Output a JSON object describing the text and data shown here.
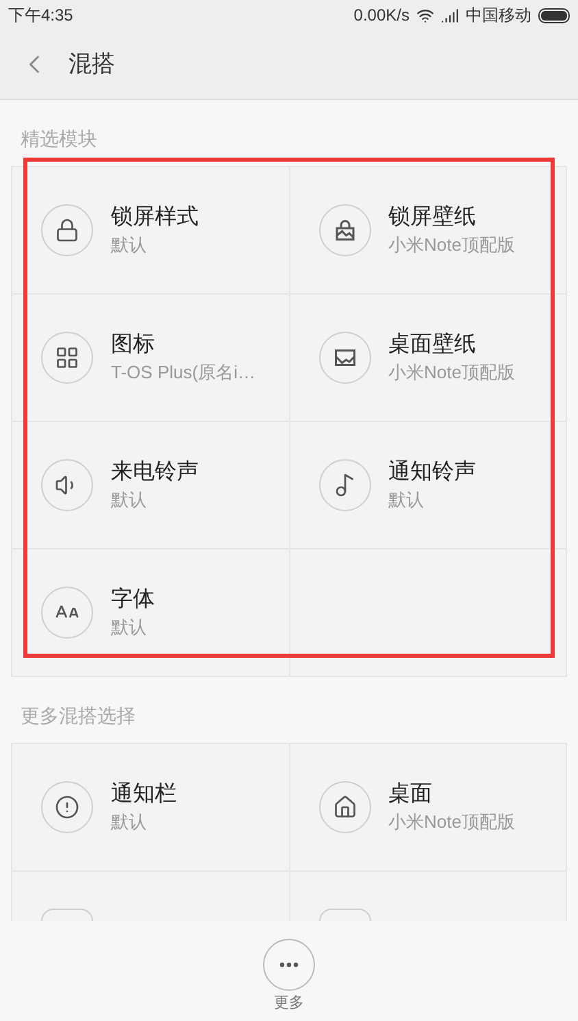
{
  "status_bar": {
    "time": "下午4:35",
    "speed": "0.00K/s",
    "carrier": "中国移动"
  },
  "header": {
    "title": "混搭"
  },
  "sections": [
    {
      "title": "精选模块",
      "highlighted": true,
      "items": [
        {
          "title": "锁屏样式",
          "subtitle": "默认",
          "kind": "lock"
        },
        {
          "title": "锁屏壁纸",
          "subtitle": "小米Note顶配版",
          "kind": "lock-image"
        },
        {
          "title": "图标",
          "subtitle": "T-OS Plus(原名i…",
          "kind": "grid"
        },
        {
          "title": "桌面壁纸",
          "subtitle": "小米Note顶配版",
          "kind": "image"
        },
        {
          "title": "来电铃声",
          "subtitle": "默认",
          "kind": "speaker"
        },
        {
          "title": "通知铃声",
          "subtitle": "默认",
          "kind": "note"
        },
        {
          "title": "字体",
          "subtitle": "默认",
          "kind": "font"
        }
      ]
    },
    {
      "title": "更多混搭选择",
      "items": [
        {
          "title": "通知栏",
          "subtitle": "默认",
          "kind": "alert"
        },
        {
          "title": "桌面",
          "subtitle": "小米Note顶配版",
          "kind": "home"
        }
      ]
    }
  ],
  "bottom_bar": {
    "label": "更多"
  }
}
